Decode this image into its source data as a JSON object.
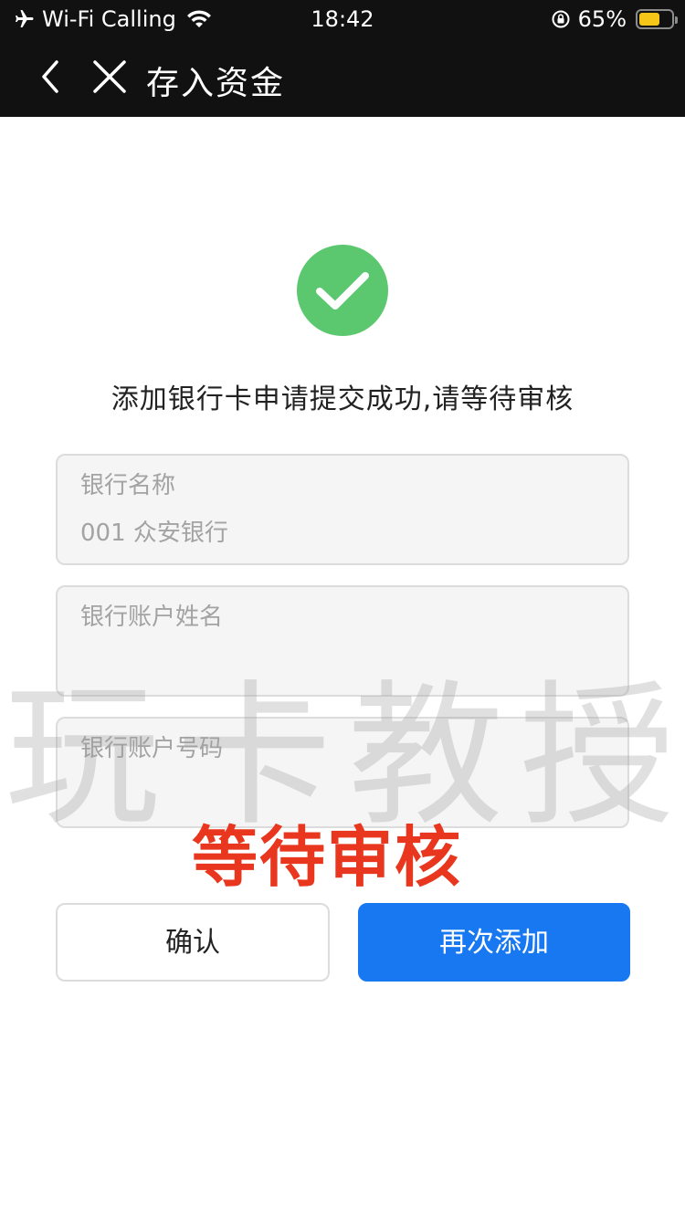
{
  "status_bar": {
    "carrier": "Wi-Fi Calling",
    "time": "18:42",
    "battery_percent_label": "65%",
    "battery_level": 0.65,
    "icons": [
      "airplane-icon",
      "wifi-icon",
      "orientation-lock-icon",
      "battery-icon"
    ]
  },
  "nav": {
    "title": "存入资金",
    "back_icon": "chevron-left-icon",
    "close_icon": "close-icon"
  },
  "success": {
    "icon": "check-circle-icon",
    "message": "添加银行卡申请提交成功,请等待审核",
    "color": "#5bc86f"
  },
  "form": {
    "bank_name": {
      "label": "银行名称",
      "value": "001 众安银行"
    },
    "account_name": {
      "label": "银行账户姓名",
      "value": ""
    },
    "account_number": {
      "label": "银行账户号码",
      "value": ""
    }
  },
  "watermark": "玩卡教授",
  "overlay_text": "等待审核",
  "buttons": {
    "confirm": "确认",
    "add_again": "再次添加",
    "primary_color": "#1778f2"
  }
}
